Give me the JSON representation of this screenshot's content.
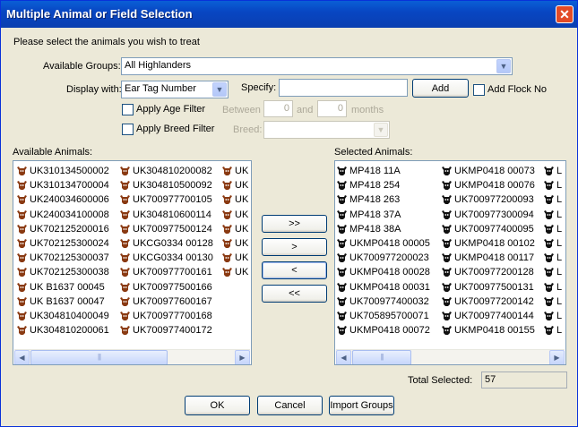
{
  "window": {
    "title": "Multiple Animal or Field Selection",
    "close_glyph": "✕"
  },
  "prompt": "Please select the animals you wish to treat",
  "groups": {
    "label": "Available Groups:",
    "value": "All Highlanders"
  },
  "display": {
    "label": "Display with:",
    "value": "Ear Tag Number"
  },
  "specify": {
    "label": "Specify:",
    "value": ""
  },
  "add_button": "Add",
  "add_flock_no": {
    "label": "Add Flock No",
    "checked": false
  },
  "age_filter": {
    "label": "Apply Age Filter",
    "between_label": "Between",
    "from": "0",
    "and_label": "and",
    "to": "0",
    "months_label": "months"
  },
  "breed_filter": {
    "label": "Apply Breed Filter",
    "breed_label": "Breed:",
    "value": ""
  },
  "available": {
    "label": "Available Animals:",
    "icon": "cow-head-icon",
    "icon_color": "#8a3a12",
    "columns": [
      [
        "UK310134500002",
        "UK310134700004",
        "UK240034600006",
        "UK240034100008",
        "UK702125200016",
        "UK702125300024",
        "UK702125300037",
        "UK702125300038",
        "UK B1637 00045",
        "UK B1637 00047",
        "UK304810400049",
        "UK304810200061"
      ],
      [
        "UK304810200082",
        "UK304810500092",
        "UK700977700105",
        "UK304810600114",
        "UK700977500124",
        "UKCG0334 00128",
        "UKCG0334 00130",
        "UK700977700161",
        "UK700977500166",
        "UK700977600167",
        "UK700977700168",
        "UK700977400172"
      ],
      [
        "UK",
        "UK",
        "UK",
        "UK",
        "UK",
        "UK",
        "UK",
        "UK"
      ]
    ]
  },
  "transfer_buttons": {
    "add_all": ">>",
    "add": ">",
    "remove": "<",
    "remove_all": "<<"
  },
  "selected": {
    "label": "Selected Animals:",
    "icon": "black-cow-head-icon",
    "icon_color": "#111111",
    "columns": [
      [
        "MP418 11A",
        "MP418 254",
        "MP418 263",
        "MP418 37A",
        "MP418 38A",
        "UKMP0418 00005",
        "UK700977200023",
        "UKMP0418 00028",
        "UKMP0418 00031",
        "UK700977400032",
        "UK705895700071",
        "UKMP0418 00072"
      ],
      [
        "UKMP0418 00073",
        "UKMP0418 00076",
        "UK700977200093",
        "UK700977300094",
        "UK700977400095",
        "UKMP0418 00102",
        "UKMP0418 00117",
        "UK700977200128",
        "UK700977500131",
        "UK700977200142",
        "UK700977400144",
        "UKMP0418 00155"
      ],
      [
        "L",
        "L",
        "L",
        "L",
        "L",
        "L",
        "L",
        "L",
        "L",
        "L",
        "L",
        "L"
      ]
    ]
  },
  "scroll_glyphs": {
    "left": "◀",
    "right": "▶",
    "down": "▼",
    "grip": "|||"
  },
  "total": {
    "label": "Total Selected:",
    "value": "57"
  },
  "footer": {
    "ok": "OK",
    "cancel": "Cancel",
    "import": "Import Groups"
  }
}
